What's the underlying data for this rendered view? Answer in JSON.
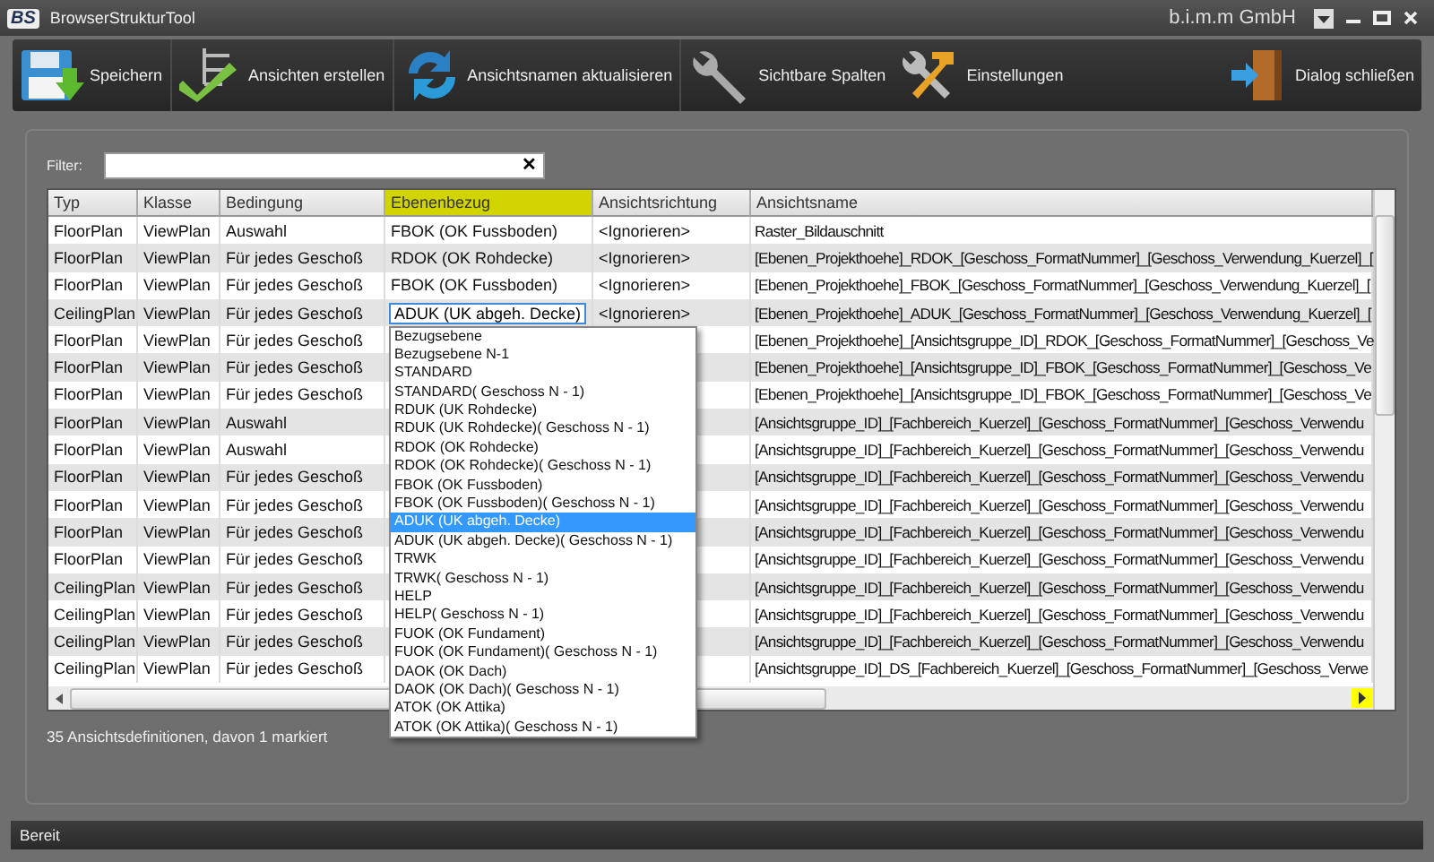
{
  "window": {
    "logo": "BS",
    "title": "BrowserStrukturTool",
    "company": "b.i.m.m GmbH"
  },
  "toolbar": [
    {
      "kind": "save",
      "label": "Speichern"
    },
    {
      "kind": "create",
      "label": "Ansichten erstellen"
    },
    {
      "kind": "refresh",
      "label": "Ansichtsnamen aktualisieren"
    },
    {
      "kind": "wrench",
      "label": "Sichtbare Spalten"
    },
    {
      "kind": "tools",
      "label": "Einstellungen"
    },
    {
      "kind": "exit",
      "label": "Dialog schließen"
    }
  ],
  "filter": {
    "label": "Filter:",
    "clear": "✕"
  },
  "table": {
    "columns": [
      {
        "label": "Typ",
        "highlighted": false
      },
      {
        "label": "Klasse",
        "highlighted": false
      },
      {
        "label": "Bedingung",
        "highlighted": false
      },
      {
        "label": "Ebenenbezug",
        "highlighted": true
      },
      {
        "label": "Ansichtsrichtung",
        "highlighted": false
      },
      {
        "label": "Ansichtsname",
        "highlighted": false
      }
    ],
    "rows": [
      {
        "typ": "FloorPlan",
        "klasse": "ViewPlan",
        "bedingung": "Auswahl",
        "ebenenbezug": "FBOK (OK Fussboden)",
        "ansichtsrichtung": "<Ignorieren>",
        "ansichtsname": "Raster_Bildauschnitt",
        "editing": false
      },
      {
        "typ": "FloorPlan",
        "klasse": "ViewPlan",
        "bedingung": "Für jedes Geschoß",
        "ebenenbezug": "RDOK (OK Rohdecke)",
        "ansichtsrichtung": "<Ignorieren>",
        "ansichtsname": "[Ebenen_Projekthoehe]_RDOK_[Geschoss_FormatNummer]_[Geschoss_Verwendung_Kuerzel]_[",
        "editing": false
      },
      {
        "typ": "FloorPlan",
        "klasse": "ViewPlan",
        "bedingung": "Für jedes Geschoß",
        "ebenenbezug": "FBOK (OK Fussboden)",
        "ansichtsrichtung": "<Ignorieren>",
        "ansichtsname": "[Ebenen_Projekthoehe]_FBOK_[Geschoss_FormatNummer]_[Geschoss_Verwendung_Kuerzel]_[",
        "editing": false
      },
      {
        "typ": "CeilingPlan",
        "klasse": "ViewPlan",
        "bedingung": "Für jedes Geschoß",
        "ebenenbezug": "ADUK (UK abgeh. Decke)",
        "ansichtsrichtung": "<Ignorieren>",
        "ansichtsname": "[Ebenen_Projekthoehe]_ADUK_[Geschoss_FormatNummer]_[Geschoss_Verwendung_Kuerzel]_[",
        "editing": true
      },
      {
        "typ": "FloorPlan",
        "klasse": "ViewPlan",
        "bedingung": "Für jedes Geschoß",
        "ansichtsname": "[Ebenen_Projekthoehe]_[Ansichtsgruppe_ID]_RDOK_[Geschoss_FormatNummer]_[Geschoss_Ve",
        "editing": false
      },
      {
        "typ": "FloorPlan",
        "klasse": "ViewPlan",
        "bedingung": "Für jedes Geschoß",
        "ansichtsname": "[Ebenen_Projekthoehe]_[Ansichtsgruppe_ID]_FBOK_[Geschoss_FormatNummer]_[Geschoss_Ve",
        "editing": false
      },
      {
        "typ": "FloorPlan",
        "klasse": "ViewPlan",
        "bedingung": "Für jedes Geschoß",
        "ansichtsname": "[Ebenen_Projekthoehe]_[Ansichtsgruppe_ID]_FBOK_[Geschoss_FormatNummer]_[Geschoss_Ve",
        "editing": false
      },
      {
        "typ": "FloorPlan",
        "klasse": "ViewPlan",
        "bedingung": "Auswahl",
        "ansichtsname": "[Ansichtsgruppe_ID]_[Fachbereich_Kuerzel]_[Geschoss_FormatNummer]_[Geschoss_Verwendu",
        "editing": false
      },
      {
        "typ": "FloorPlan",
        "klasse": "ViewPlan",
        "bedingung": "Auswahl",
        "ansichtsname": "[Ansichtsgruppe_ID]_[Fachbereich_Kuerzel]_[Geschoss_FormatNummer]_[Geschoss_Verwendu",
        "editing": false
      },
      {
        "typ": "FloorPlan",
        "klasse": "ViewPlan",
        "bedingung": "Für jedes Geschoß",
        "ansichtsname": "[Ansichtsgruppe_ID]_[Fachbereich_Kuerzel]_[Geschoss_FormatNummer]_[Geschoss_Verwendu",
        "editing": false
      },
      {
        "typ": "FloorPlan",
        "klasse": "ViewPlan",
        "bedingung": "Für jedes Geschoß",
        "ansichtsname": "[Ansichtsgruppe_ID]_[Fachbereich_Kuerzel]_[Geschoss_FormatNummer]_[Geschoss_Verwendu",
        "editing": false
      },
      {
        "typ": "FloorPlan",
        "klasse": "ViewPlan",
        "bedingung": "Für jedes Geschoß",
        "ansichtsname": "[Ansichtsgruppe_ID]_[Fachbereich_Kuerzel]_[Geschoss_FormatNummer]_[Geschoss_Verwendu",
        "editing": false
      },
      {
        "typ": "FloorPlan",
        "klasse": "ViewPlan",
        "bedingung": "Für jedes Geschoß",
        "ansichtsname": "[Ansichtsgruppe_ID]_[Fachbereich_Kuerzel]_[Geschoss_FormatNummer]_[Geschoss_Verwendu",
        "editing": false
      },
      {
        "typ": "CeilingPlan",
        "klasse": "ViewPlan",
        "bedingung": "Für jedes Geschoß",
        "ansichtsname": "[Ansichtsgruppe_ID]_[Fachbereich_Kuerzel]_[Geschoss_FormatNummer]_[Geschoss_Verwendu",
        "editing": false
      },
      {
        "typ": "CeilingPlan",
        "klasse": "ViewPlan",
        "bedingung": "Für jedes Geschoß",
        "ansichtsname": "[Ansichtsgruppe_ID]_[Fachbereich_Kuerzel]_[Geschoss_FormatNummer]_[Geschoss_Verwendu",
        "editing": false
      },
      {
        "typ": "CeilingPlan",
        "klasse": "ViewPlan",
        "bedingung": "Für jedes Geschoß",
        "ansichtsname": "[Ansichtsgruppe_ID]_[Fachbereich_Kuerzel]_[Geschoss_FormatNummer]_[Geschoss_Verwendu",
        "editing": false
      },
      {
        "typ": "CeilingPlan",
        "klasse": "ViewPlan",
        "bedingung": "Für jedes Geschoß",
        "ansichtsname": "[Ansichtsgruppe_ID]_DS_[Fachbereich_Kuerzel]_[Geschoss_FormatNummer]_[Geschoss_Verwe",
        "editing": false
      }
    ],
    "dropdown": [
      {
        "label": "Bezugsebene",
        "selected": false
      },
      {
        "label": "Bezugsebene N-1",
        "selected": false
      },
      {
        "label": "STANDARD",
        "selected": false
      },
      {
        "label": "STANDARD( Geschoss N - 1)",
        "selected": false
      },
      {
        "label": "RDUK (UK Rohdecke)",
        "selected": false
      },
      {
        "label": "RDUK (UK Rohdecke)( Geschoss N - 1)",
        "selected": false
      },
      {
        "label": "RDOK (OK Rohdecke)",
        "selected": false
      },
      {
        "label": "RDOK (OK Rohdecke)( Geschoss N - 1)",
        "selected": false
      },
      {
        "label": "FBOK (OK Fussboden)",
        "selected": false
      },
      {
        "label": "FBOK (OK Fussboden)( Geschoss N - 1)",
        "selected": false
      },
      {
        "label": "ADUK (UK abgeh. Decke)",
        "selected": true
      },
      {
        "label": "ADUK (UK abgeh. Decke)( Geschoss N - 1)",
        "selected": false
      },
      {
        "label": "TRWK",
        "selected": false
      },
      {
        "label": "TRWK( Geschoss N - 1)",
        "selected": false
      },
      {
        "label": "HELP",
        "selected": false
      },
      {
        "label": "HELP( Geschoss N - 1)",
        "selected": false
      },
      {
        "label": "FUOK (OK Fundament)",
        "selected": false
      },
      {
        "label": "FUOK (OK Fundament)( Geschoss N - 1)",
        "selected": false
      },
      {
        "label": "DAOK (OK Dach)",
        "selected": false
      },
      {
        "label": "DAOK (OK Dach)( Geschoss N - 1)",
        "selected": false
      },
      {
        "label": "ATOK (OK Attika)",
        "selected": false
      },
      {
        "label": "ATOK (OK Attika)( Geschoss N - 1)",
        "selected": false
      }
    ]
  },
  "summary": "35 Ansichtsdefinitionen, davon 1 markiert",
  "status_bar": "Bereit"
}
